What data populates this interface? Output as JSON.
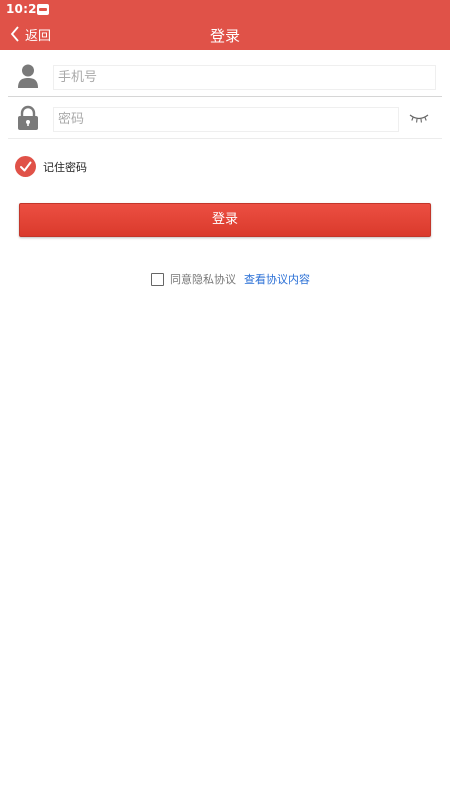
{
  "status_bar": {
    "time": "10:23"
  },
  "nav": {
    "back_label": "返回",
    "title": "登录"
  },
  "form": {
    "phone": {
      "placeholder": "手机号",
      "value": ""
    },
    "password": {
      "placeholder": "密码",
      "value": ""
    },
    "remember_label": "记住密码",
    "remember_checked": true,
    "login_button": "登录"
  },
  "agreement": {
    "label": "同意隐私协议",
    "link_text": "查看协议内容",
    "checked": false
  },
  "colors": {
    "brand": "#e05248",
    "button": "#e34134",
    "link": "#2a6fd6"
  },
  "icons": {
    "back": "chevron-left-icon",
    "phone": "user-icon",
    "password": "lock-icon",
    "toggle_visibility": "eye-closed-icon",
    "remember": "check-circle-icon",
    "agreement": "checkbox-icon"
  }
}
